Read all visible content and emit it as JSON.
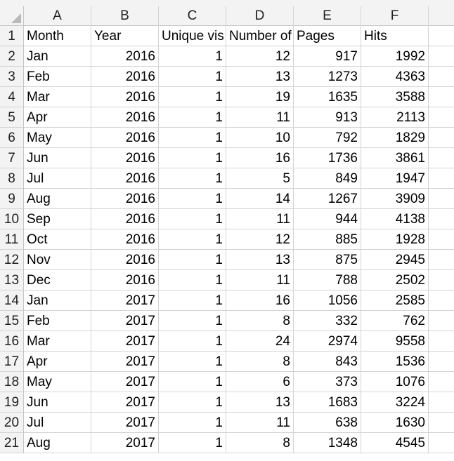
{
  "columns": [
    "A",
    "B",
    "C",
    "D",
    "E",
    "F",
    ""
  ],
  "rows": [
    {
      "num": "1",
      "cells": [
        "Month",
        "Year",
        "Unique vis",
        "Number of",
        "Pages",
        "Hits",
        ""
      ]
    },
    {
      "num": "2",
      "cells": [
        "Jan",
        "2016",
        "1",
        "12",
        "917",
        "1992",
        ""
      ]
    },
    {
      "num": "3",
      "cells": [
        "Feb",
        "2016",
        "1",
        "13",
        "1273",
        "4363",
        ""
      ]
    },
    {
      "num": "4",
      "cells": [
        "Mar",
        "2016",
        "1",
        "19",
        "1635",
        "3588",
        ""
      ]
    },
    {
      "num": "5",
      "cells": [
        "Apr",
        "2016",
        "1",
        "11",
        "913",
        "2113",
        ""
      ]
    },
    {
      "num": "6",
      "cells": [
        "May",
        "2016",
        "1",
        "10",
        "792",
        "1829",
        ""
      ]
    },
    {
      "num": "7",
      "cells": [
        "Jun",
        "2016",
        "1",
        "16",
        "1736",
        "3861",
        ""
      ]
    },
    {
      "num": "8",
      "cells": [
        "Jul",
        "2016",
        "1",
        "5",
        "849",
        "1947",
        ""
      ]
    },
    {
      "num": "9",
      "cells": [
        "Aug",
        "2016",
        "1",
        "14",
        "1267",
        "3909",
        ""
      ]
    },
    {
      "num": "10",
      "cells": [
        "Sep",
        "2016",
        "1",
        "11",
        "944",
        "4138",
        ""
      ]
    },
    {
      "num": "11",
      "cells": [
        "Oct",
        "2016",
        "1",
        "12",
        "885",
        "1928",
        ""
      ]
    },
    {
      "num": "12",
      "cells": [
        "Nov",
        "2016",
        "1",
        "13",
        "875",
        "2945",
        ""
      ]
    },
    {
      "num": "13",
      "cells": [
        "Dec",
        "2016",
        "1",
        "11",
        "788",
        "2502",
        ""
      ]
    },
    {
      "num": "14",
      "cells": [
        "Jan",
        "2017",
        "1",
        "16",
        "1056",
        "2585",
        ""
      ]
    },
    {
      "num": "15",
      "cells": [
        "Feb",
        "2017",
        "1",
        "8",
        "332",
        "762",
        ""
      ]
    },
    {
      "num": "16",
      "cells": [
        "Mar",
        "2017",
        "1",
        "24",
        "2974",
        "9558",
        ""
      ]
    },
    {
      "num": "17",
      "cells": [
        "Apr",
        "2017",
        "1",
        "8",
        "843",
        "1536",
        ""
      ]
    },
    {
      "num": "18",
      "cells": [
        "May",
        "2017",
        "1",
        "6",
        "373",
        "1076",
        ""
      ]
    },
    {
      "num": "19",
      "cells": [
        "Jun",
        "2017",
        "1",
        "13",
        "1683",
        "3224",
        ""
      ]
    },
    {
      "num": "20",
      "cells": [
        "Jul",
        "2017",
        "1",
        "11",
        "638",
        "1630",
        ""
      ]
    },
    {
      "num": "21",
      "cells": [
        "Aug",
        "2017",
        "1",
        "8",
        "1348",
        "4545",
        ""
      ]
    }
  ]
}
